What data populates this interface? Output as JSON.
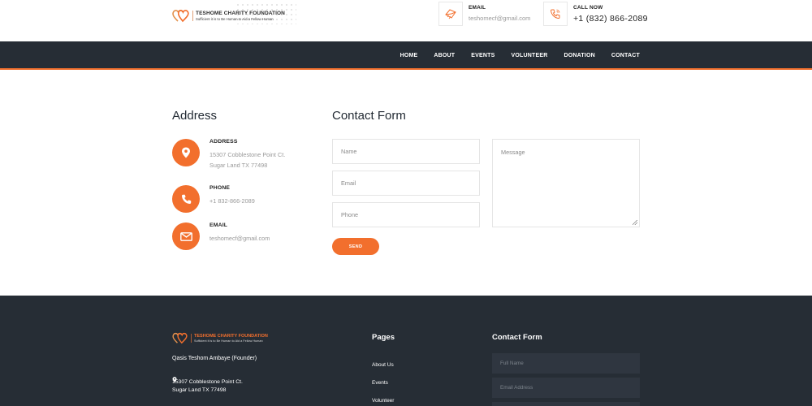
{
  "brand": {
    "name": "TESHOME CHARITY FOUNDATION",
    "tagline": "Sufficient it is to Be Human to Aid a Fellow Human"
  },
  "header": {
    "email": {
      "label": "EMAIL",
      "value": "teshomecf@gmail.com",
      "icon": "envelope-line-icon"
    },
    "call": {
      "label": "CALL NOW",
      "value": "+1 (832) 866-2089",
      "icon": "phone-ring-icon"
    }
  },
  "nav": {
    "items": [
      "HOME",
      "ABOUT",
      "EVENTS",
      "VOLUNTEER",
      "DONATION",
      "CONTACT"
    ]
  },
  "address_section": {
    "title": "Address",
    "items": [
      {
        "label": "ADDRESS",
        "lines": [
          "15307 Cobblestone Point Ct.",
          "Sugar Land TX 77498"
        ],
        "icon": "map-pin-icon"
      },
      {
        "label": "PHONE",
        "lines": [
          "+1 832-866-2089"
        ],
        "icon": "phone-icon"
      },
      {
        "label": "EMAIL",
        "lines": [
          "teshomecf@gmail.com"
        ],
        "icon": "envelope-icon"
      }
    ]
  },
  "contact_form": {
    "title": "Contact Form",
    "name_placeholder": "Name",
    "email_placeholder": "Email",
    "phone_placeholder": "Phone",
    "message_placeholder": "Message",
    "send_label": "SEND"
  },
  "footer": {
    "founder": "Qasis Teshom Ambaye (Founder)",
    "address_lines": [
      "15307 Cobblestone Point Ct.",
      "Sugar Land TX 77498"
    ],
    "pages_title": "Pages",
    "pages": [
      "About Us",
      "Events",
      "Volunteer"
    ],
    "form_title": "Contact Form",
    "form_fields": [
      "Full Name",
      "Email Address"
    ]
  },
  "colors": {
    "accent": "#f26f2d",
    "dark": "#262d35",
    "muted_text": "#9a9a9a"
  }
}
